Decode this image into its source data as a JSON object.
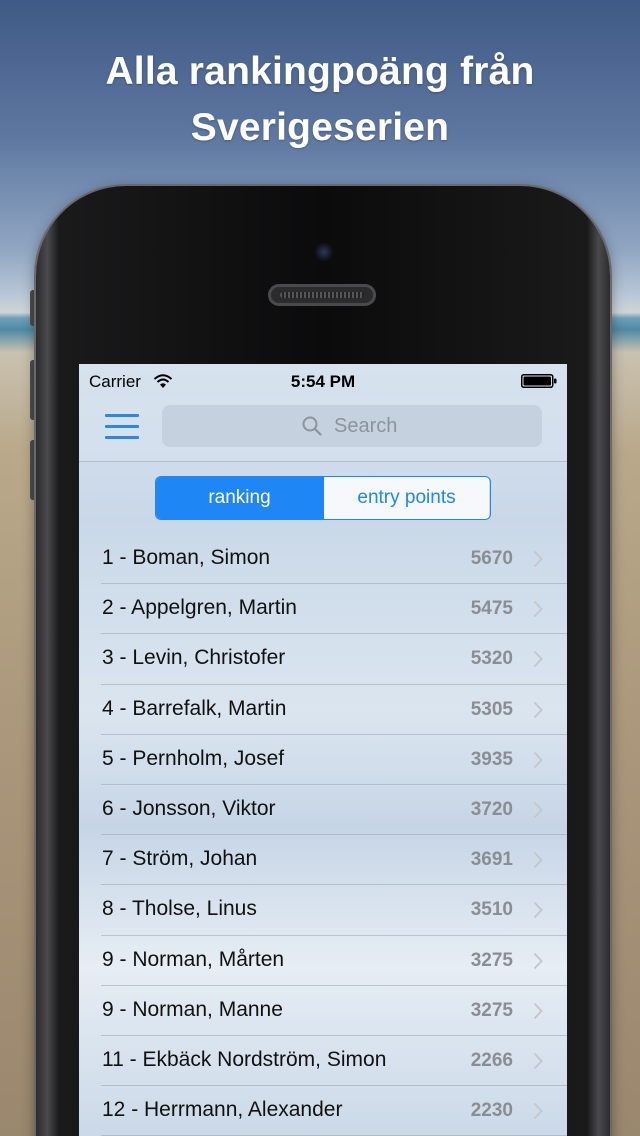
{
  "headline": {
    "line1": "Alla rankingpoäng från",
    "line2": "Sverigeserien"
  },
  "statusbar": {
    "carrier": "Carrier",
    "time": "5:54 PM"
  },
  "search": {
    "placeholder": "Search"
  },
  "segments": {
    "active": "ranking",
    "inactive": "entry points"
  },
  "rows": [
    {
      "label": "1 - Boman, Simon",
      "value": "5670"
    },
    {
      "label": "2 - Appelgren, Martin",
      "value": "5475"
    },
    {
      "label": "3 - Levin, Christofer",
      "value": "5320"
    },
    {
      "label": "4 - Barrefalk, Martin",
      "value": "5305"
    },
    {
      "label": "5 - Pernholm, Josef",
      "value": "3935"
    },
    {
      "label": "6 - Jonsson, Viktor",
      "value": "3720"
    },
    {
      "label": "7 - Ström, Johan",
      "value": "3691"
    },
    {
      "label": "8 - Tholse, Linus",
      "value": "3510"
    },
    {
      "label": "9 - Norman, Mårten",
      "value": "3275"
    },
    {
      "label": "9 - Norman, Manne",
      "value": "3275"
    },
    {
      "label": "11 - Ekbäck Nordström, Simon",
      "value": "2266"
    },
    {
      "label": "12 - Herrmann, Alexander",
      "value": "2230"
    }
  ],
  "colors": {
    "accent": "#1f86f5",
    "value_gray": "#8a8e93"
  },
  "icons": [
    "wifi-icon",
    "battery-icon",
    "menu-icon",
    "search-icon",
    "chevron-right-icon"
  ]
}
